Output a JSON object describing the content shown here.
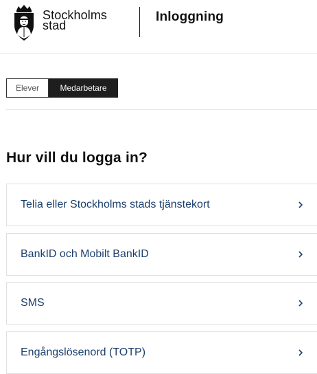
{
  "header": {
    "brand_line1": "Stockholms",
    "brand_line2": "stad",
    "app_title": "Inloggning",
    "logo_icon": "stockholm-crest-icon"
  },
  "tabs": [
    {
      "label": "Elever",
      "active": false
    },
    {
      "label": "Medarbetare",
      "active": true
    }
  ],
  "main": {
    "heading": "Hur vill du logga in?",
    "options": [
      {
        "label": "Telia eller Stockholms stads tjänstekort",
        "icon": "chevron-right-icon"
      },
      {
        "label": "BankID och Mobilt BankID",
        "icon": "chevron-right-icon"
      },
      {
        "label": "SMS",
        "icon": "chevron-right-icon"
      },
      {
        "label": "Engångslösenord (TOTP)",
        "icon": "chevron-right-icon"
      }
    ]
  },
  "colors": {
    "link": "#1b3f6d",
    "active_tab_bg": "#1e1e1e",
    "text": "#111111"
  }
}
